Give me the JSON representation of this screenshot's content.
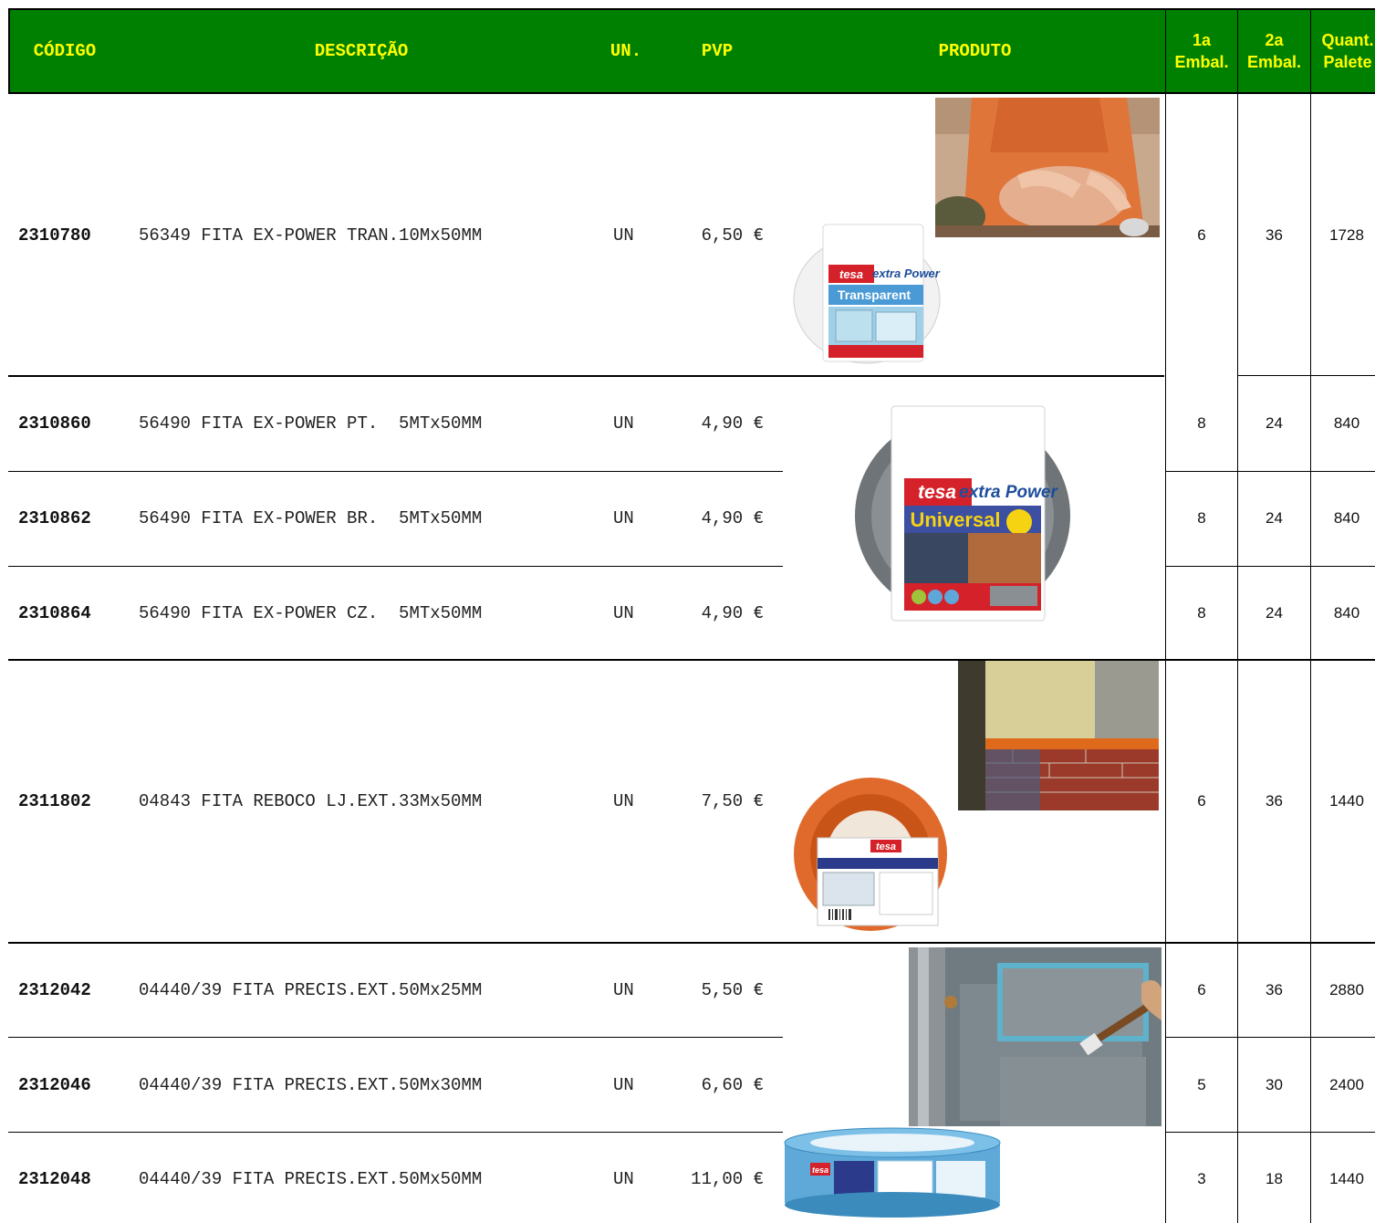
{
  "header": {
    "codigo": "CÓDIGO",
    "descricao": "DESCRIÇÃO",
    "un": "UN.",
    "pvp": "PVP",
    "produto": "PRODUTO",
    "emb1_line1": "1a",
    "emb1_line2": "Embal.",
    "emb2_line1": "2a",
    "emb2_line2": "Embal.",
    "pal_line1": "Quant.",
    "pal_line2": "Palete"
  },
  "colors": {
    "header_bg": "#008000",
    "header_text": "#ffff00"
  },
  "rows": [
    {
      "codigo": "2310780",
      "descricao": "56349 FITA EX-POWER TRAN.10Mx50MM",
      "un": "UN",
      "pvp": "6,50 €",
      "emb1": "6",
      "emb2": "36",
      "palete": "1728"
    },
    {
      "codigo": "2310860",
      "descricao": "56490 FITA EX-POWER PT.  5MTx50MM",
      "un": "UN",
      "pvp": "4,90 €",
      "emb1": "8",
      "emb2": "24",
      "palete": "840"
    },
    {
      "codigo": "2310862",
      "descricao": "56490 FITA EX-POWER BR.  5MTx50MM",
      "un": "UN",
      "pvp": "4,90 €",
      "emb1": "8",
      "emb2": "24",
      "palete": "840"
    },
    {
      "codigo": "2310864",
      "descricao": "56490 FITA EX-POWER CZ.  5MTx50MM",
      "un": "UN",
      "pvp": "4,90 €",
      "emb1": "8",
      "emb2": "24",
      "palete": "840"
    },
    {
      "codigo": "2311802",
      "descricao": "04843 FITA REBOCO LJ.EXT.33Mx50MM",
      "un": "UN",
      "pvp": "7,50 €",
      "emb1": "6",
      "emb2": "36",
      "palete": "1440"
    },
    {
      "codigo": "2312042",
      "descricao": "04440/39 FITA PRECIS.EXT.50Mx25MM",
      "un": "UN",
      "pvp": "5,50 €",
      "emb1": "6",
      "emb2": "36",
      "palete": "2880"
    },
    {
      "codigo": "2312046",
      "descricao": "04440/39 FITA PRECIS.EXT.50Mx30MM",
      "un": "UN",
      "pvp": "6,60 €",
      "emb1": "5",
      "emb2": "30",
      "palete": "2400"
    },
    {
      "codigo": "2312048",
      "descricao": "04440/39 FITA PRECIS.EXT.50Mx50MM",
      "un": "UN",
      "pvp": "11,00 €",
      "emb1": "3",
      "emb2": "18",
      "palete": "1440"
    }
  ],
  "product_images": {
    "tape1_brand": "tesa",
    "tape1_line": "extra Power",
    "tape1_name": "Transparent",
    "tape2_brand": "tesa",
    "tape2_line": "extra Power",
    "tape2_name": "Universal",
    "tape3_brand": "tesa",
    "tape4_brand": "tesa"
  }
}
